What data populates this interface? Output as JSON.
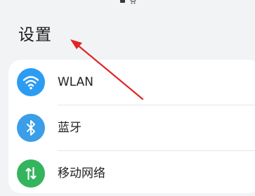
{
  "header": {
    "title": "设置"
  },
  "status_icons": [
    "notification-square-icon",
    "shopping-cart-icon"
  ],
  "settings": {
    "items": [
      {
        "label": "WLAN",
        "icon": "wifi-icon",
        "color": "#2b9cf2"
      },
      {
        "label": "蓝牙",
        "icon": "bluetooth-icon",
        "color": "#3a9ee8"
      },
      {
        "label": "移动网络",
        "icon": "mobile-data-icon",
        "color": "#34b45c"
      }
    ]
  },
  "annotation": {
    "arrow_color": "#e02525"
  }
}
